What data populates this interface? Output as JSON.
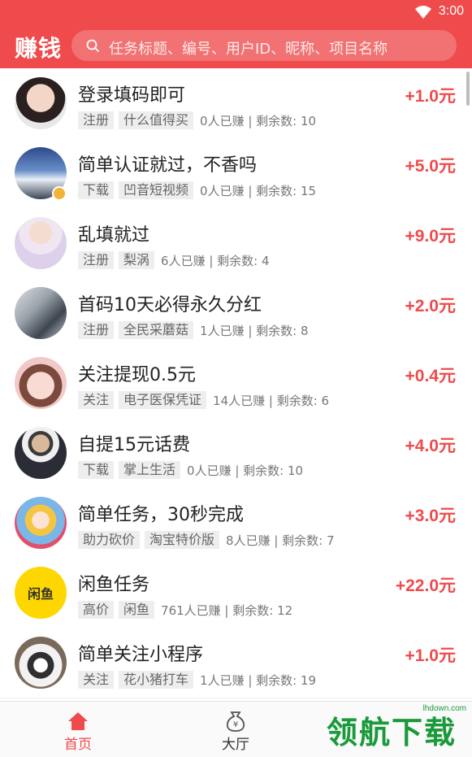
{
  "status_bar": {
    "time": "3:00"
  },
  "header": {
    "brand": "赚钱",
    "search_placeholder": "任务标题、编号、用户ID、昵称、项目名称"
  },
  "colors": {
    "accent": "#ef4b4c",
    "tag_bg": "#eeeeee"
  },
  "tasks": [
    {
      "title": "登录填码即可",
      "tags": [
        "注册",
        "什么值得买"
      ],
      "stats": "0人已赚 | 剩余数: 10",
      "reward": "+1.0元",
      "avatar": "girl-portrait"
    },
    {
      "title": "简单认证就过，不香吗",
      "tags": [
        "下载",
        "凹音短视频"
      ],
      "stats": "0人已赚 | 剩余数: 15",
      "reward": "+5.0元",
      "avatar": "sky-landscape"
    },
    {
      "title": "乱填就过",
      "tags": [
        "注册",
        "梨涡"
      ],
      "stats": "6人已赚 | 剩余数: 4",
      "reward": "+9.0元",
      "avatar": "girl-white-shirt"
    },
    {
      "title": "首码10天必得永久分红",
      "tags": [
        "注册",
        "全民采蘑菇"
      ],
      "stats": "1人已赚 | 剩余数: 8",
      "reward": "+2.0元",
      "avatar": "girl-sketch"
    },
    {
      "title": "关注提现0.5元",
      "tags": [
        "关注",
        "电子医保凭证"
      ],
      "stats": "14人已赚 | 剩余数: 6",
      "reward": "+0.4元",
      "avatar": "anime-boy"
    },
    {
      "title": "自提15元话费",
      "tags": [
        "下载",
        "掌上生活"
      ],
      "stats": "0人已赚 | 剩余数: 10",
      "reward": "+4.0元",
      "avatar": "man-suit"
    },
    {
      "title": "简单任务，30秒完成",
      "tags": [
        "助力砍价",
        "淘宝特价版"
      ],
      "stats": "8人已赚 | 剩余数: 7",
      "reward": "+3.0元",
      "avatar": "anime-girl"
    },
    {
      "title": "闲鱼任务",
      "tags": [
        "高价",
        "闲鱼"
      ],
      "stats": "761人已赚 | 剩余数: 12",
      "reward": "+22.0元",
      "avatar": "xianyu-logo",
      "avatar_text": "闲鱼"
    },
    {
      "title": "简单关注小程序",
      "tags": [
        "关注",
        "花小猪打车"
      ],
      "stats": "1人已赚 | 剩余数: 19",
      "reward": "+1.0元",
      "avatar": "husky-dog"
    }
  ],
  "bottom_nav": [
    {
      "label": "首页",
      "icon": "home-icon",
      "active": true
    },
    {
      "label": "大厅",
      "icon": "money-bag-icon",
      "active": false
    }
  ],
  "watermark": {
    "text": "领航下载",
    "url": "lhdown.com"
  }
}
